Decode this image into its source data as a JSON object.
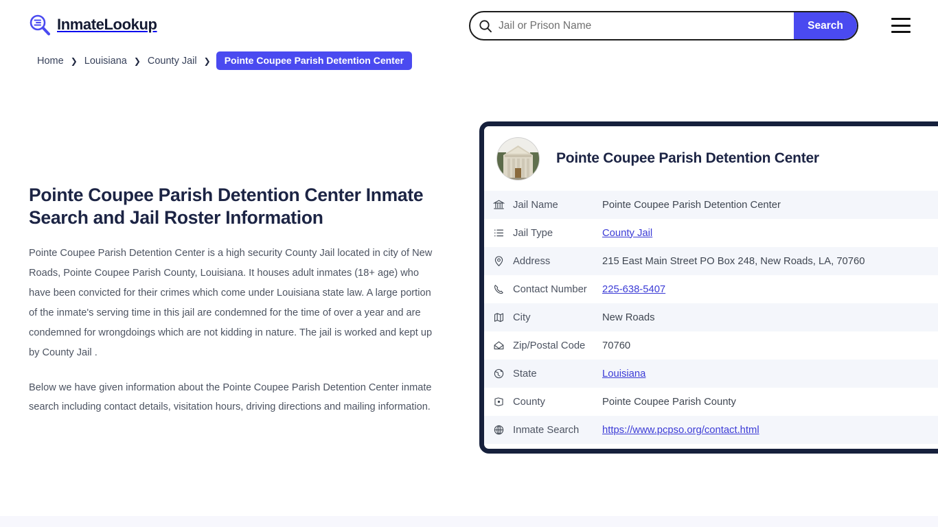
{
  "header": {
    "logo_text": "InmateLookup",
    "logo_icon": "magnifier-list-icon",
    "menu_icon": "hamburger-menu-icon"
  },
  "search": {
    "icon": "search-icon",
    "placeholder": "Jail or Prison Name",
    "value": "",
    "button_label": "Search"
  },
  "breadcrumb": {
    "items": [
      {
        "label": "Home"
      },
      {
        "label": "Louisiana"
      },
      {
        "label": "County Jail"
      }
    ],
    "separator": "❯",
    "current": "Pointe Coupee Parish Detention Center"
  },
  "main": {
    "title": "Pointe Coupee Parish Detention Center Inmate Search and Jail Roster Information",
    "paragraphs": [
      "Pointe Coupee Parish Detention Center is a high security County Jail located in city of New Roads, Pointe Coupee Parish County, Louisiana. It houses adult inmates (18+ age) who have been convicted for their crimes which come under Louisiana state law. A large portion of the inmate's serving time in this jail are condemned for the time of over a year and are condemned for wrongdoings which are not kidding in nature. The jail is worked and kept up by County Jail .",
      "Below we have given information about the Pointe Coupee Parish Detention Center inmate search including contact details, visitation hours, driving directions and mailing information."
    ]
  },
  "card": {
    "thumbnail_alt": "courthouse-photo",
    "title": "Pointe Coupee Parish Detention Center",
    "rows": [
      {
        "icon": "bank-icon",
        "label": "Jail Name",
        "value": "Pointe Coupee Parish Detention Center",
        "link": false
      },
      {
        "icon": "list-icon",
        "label": "Jail Type",
        "value": "County Jail",
        "link": true
      },
      {
        "icon": "map-pin-icon",
        "label": "Address",
        "value": "215 East Main Street PO Box 248, New Roads, LA, 70760",
        "link": false
      },
      {
        "icon": "phone-icon",
        "label": "Contact Number",
        "value": "225-638-5407",
        "link": true
      },
      {
        "icon": "map-icon",
        "label": "City",
        "value": "New Roads",
        "link": false
      },
      {
        "icon": "envelope-icon",
        "label": "Zip/Postal Code",
        "value": "70760",
        "link": false
      },
      {
        "icon": "globe-pin-icon",
        "label": "State",
        "value": "Louisiana",
        "link": true
      },
      {
        "icon": "county-badge-icon",
        "label": "County",
        "value": "Pointe Coupee Parish County",
        "link": false
      },
      {
        "icon": "globe-icon",
        "label": "Inmate Search",
        "value": "https://www.pcpso.org/contact.html",
        "link": true
      }
    ]
  },
  "colors": {
    "accent": "#4a4af0",
    "card_border": "#16203c",
    "heading": "#1c2444",
    "body_text": "#4c5361",
    "row_alt": "#f4f6fb",
    "link": "#3b3bd6"
  }
}
